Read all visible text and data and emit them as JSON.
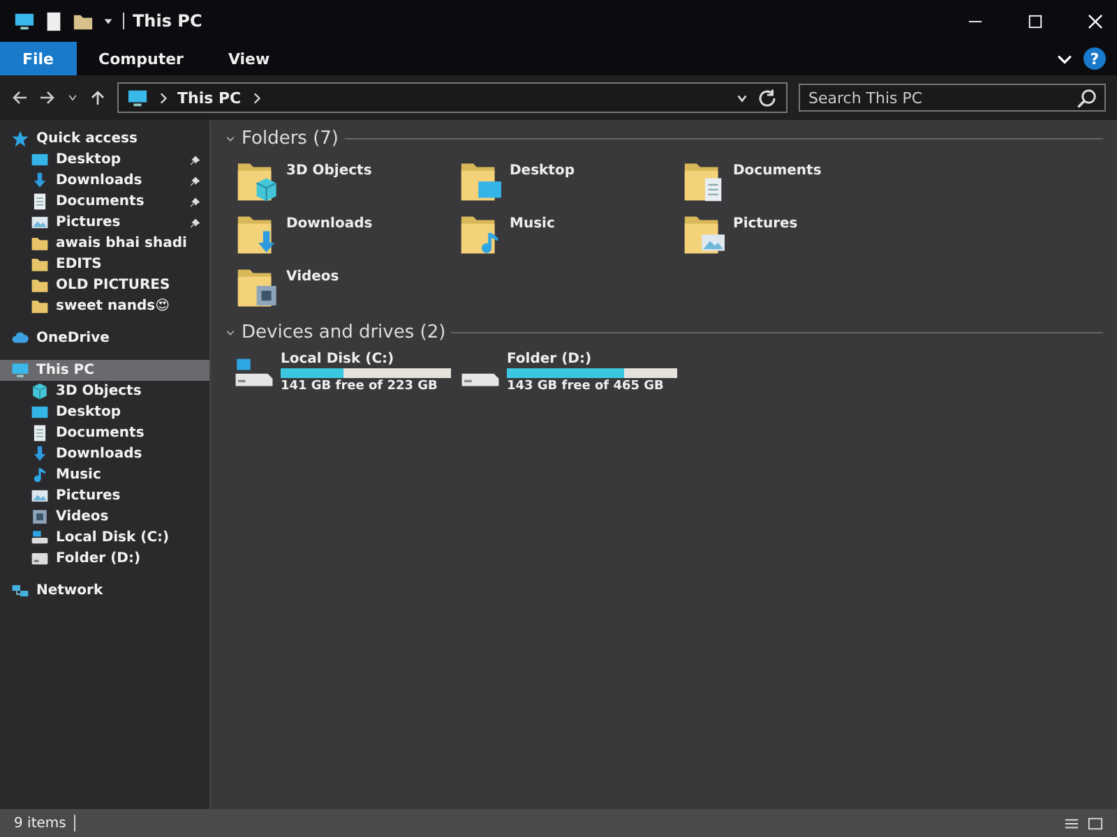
{
  "window": {
    "title": "This PC"
  },
  "ribbon": {
    "tabs": [
      {
        "label": "File",
        "selected": true
      },
      {
        "label": "Computer",
        "selected": false
      },
      {
        "label": "View",
        "selected": false
      }
    ],
    "help": "?"
  },
  "address": {
    "path": [
      "This PC"
    ]
  },
  "search": {
    "placeholder": "Search This PC"
  },
  "nav": [
    {
      "label": "Quick access",
      "kind": "star",
      "selected": false,
      "children": [
        {
          "label": "Desktop",
          "kind": "desktop",
          "selected": false,
          "pinned": true
        },
        {
          "label": "Downloads",
          "kind": "downloads",
          "selected": false,
          "pinned": true
        },
        {
          "label": "Documents",
          "kind": "documents",
          "selected": false,
          "pinned": true
        },
        {
          "label": "Pictures",
          "kind": "pictures",
          "selected": false,
          "pinned": true
        },
        {
          "label": "awais bhai shadi",
          "kind": "folder",
          "selected": false,
          "pinned": false
        },
        {
          "label": "EDITS",
          "kind": "folder",
          "selected": false,
          "pinned": false
        },
        {
          "label": "OLD PICTURES",
          "kind": "folder",
          "selected": false,
          "pinned": false
        },
        {
          "label": "sweet nands😍",
          "kind": "folder",
          "selected": false,
          "pinned": false
        }
      ]
    },
    {
      "label": "OneDrive",
      "kind": "cloud",
      "selected": false
    },
    {
      "label": "This PC",
      "kind": "pc",
      "selected": true,
      "children": [
        {
          "label": "3D Objects",
          "kind": "cube",
          "selected": false
        },
        {
          "label": "Desktop",
          "kind": "desktop",
          "selected": false
        },
        {
          "label": "Documents",
          "kind": "documents",
          "selected": false
        },
        {
          "label": "Downloads",
          "kind": "downloads",
          "selected": false
        },
        {
          "label": "Music",
          "kind": "music",
          "selected": false
        },
        {
          "label": "Pictures",
          "kind": "pictures",
          "selected": false
        },
        {
          "label": "Videos",
          "kind": "videos",
          "selected": false
        },
        {
          "label": "Local Disk (C:)",
          "kind": "drive-system",
          "selected": false
        },
        {
          "label": "Folder (D:)",
          "kind": "drive",
          "selected": false
        }
      ]
    },
    {
      "label": "Network",
      "kind": "network",
      "selected": false
    }
  ],
  "folders": {
    "heading": "Folders (7)",
    "items": [
      {
        "label": "3D Objects",
        "kind": "cube"
      },
      {
        "label": "Desktop",
        "kind": "desktop"
      },
      {
        "label": "Documents",
        "kind": "documents"
      },
      {
        "label": "Downloads",
        "kind": "downloads"
      },
      {
        "label": "Music",
        "kind": "music"
      },
      {
        "label": "Pictures",
        "kind": "pictures"
      },
      {
        "label": "Videos",
        "kind": "videos"
      }
    ]
  },
  "drives": {
    "heading": "Devices and drives (2)",
    "items": [
      {
        "label": "Local Disk (C:)",
        "kind": "drive-system",
        "level": 0.37,
        "reading": "141 GB free of 223 GB"
      },
      {
        "label": "Folder (D:)",
        "kind": "drive",
        "level": 0.69,
        "reading": "143 GB free of 465 GB"
      }
    ]
  },
  "status_bar": {
    "count": "9 items"
  }
}
